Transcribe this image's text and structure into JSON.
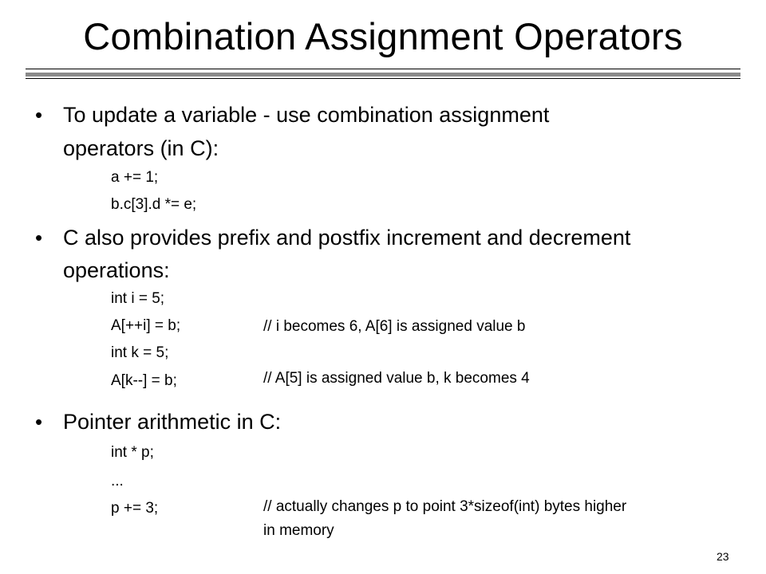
{
  "slide": {
    "title": "Combination Assignment Operators",
    "page_number": "23",
    "bullet_symbol": "•",
    "bullets": [
      {
        "text_line1": "To update a variable - use combination assignment",
        "text_line2": "operators (in C):",
        "code": [
          "a += 1;",
          "b.c[3].d *= e;"
        ]
      },
      {
        "text_line1": "C also provides prefix and postfix increment and decrement",
        "text_line2": "operations:",
        "code": [
          "int i = 5;",
          "A[++i] = b;",
          "int k = 5;",
          "A[k--] = b;"
        ],
        "comments": [
          "// i becomes 6, A[6] is assigned value b",
          "// A[5] is assigned value b, k becomes 4"
        ]
      },
      {
        "text_line1": "Pointer arithmetic in C:",
        "code": [
          "int * p;",
          "...",
          "p += 3;"
        ],
        "comments": [
          "// actually changes p to point 3*sizeof(int) bytes higher",
          "in memory"
        ]
      }
    ]
  }
}
